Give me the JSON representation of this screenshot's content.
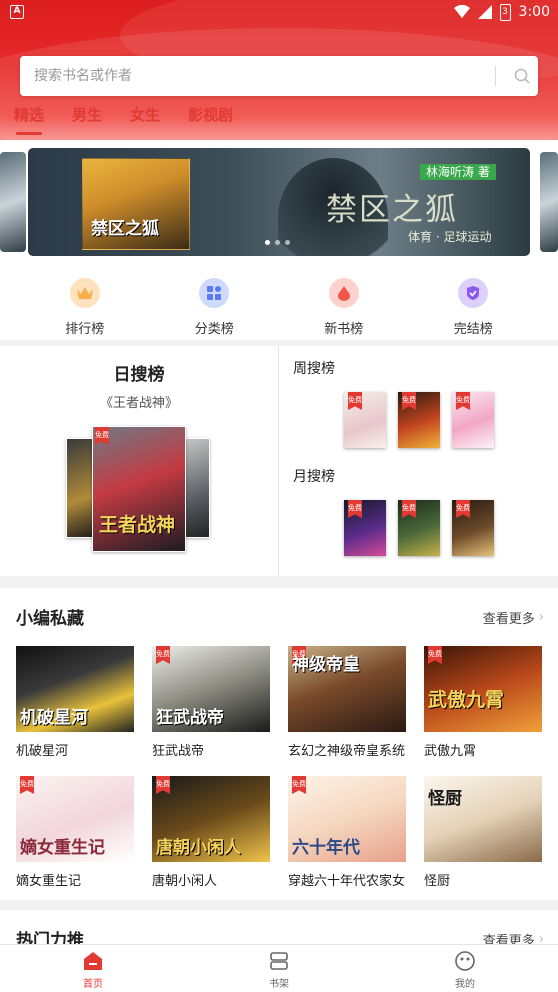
{
  "status_bar": {
    "time": "3:00",
    "battery_level": "3",
    "left_indicator": "A"
  },
  "search": {
    "placeholder": "搜索书名或作者",
    "icon": "search-icon"
  },
  "tabs": [
    {
      "label": "精选",
      "active": true
    },
    {
      "label": "男生",
      "active": false
    },
    {
      "label": "女生",
      "active": false
    },
    {
      "label": "影视剧",
      "active": false
    }
  ],
  "banner": {
    "cover_text": "禁区之狐",
    "author": "林海听涛 著",
    "title": "禁区之狐",
    "subtitle": "体育 · 足球运动",
    "slide_count": 3,
    "active_slide": 1
  },
  "quick_nav": [
    {
      "label": "排行榜",
      "icon": "crown-icon",
      "color": "#f6b04a"
    },
    {
      "label": "分类榜",
      "icon": "grid-icon",
      "color": "#5b7cf0"
    },
    {
      "label": "新书榜",
      "icon": "drop-icon",
      "color": "#f2574a"
    },
    {
      "label": "完结榜",
      "icon": "badge-check-icon",
      "color": "#8a5bee"
    }
  ],
  "rankings": {
    "daily": {
      "title": "日搜榜",
      "book": "《王者战神》",
      "cover_text": "王者战神"
    },
    "weekly": {
      "title": "周搜榜"
    },
    "monthly": {
      "title": "月搜榜"
    }
  },
  "editor_picks": {
    "title": "小编私藏",
    "more": "查看更多",
    "books": [
      {
        "name": "机破星河",
        "cover_text": "机破星河",
        "free": false
      },
      {
        "name": "狂武战帝",
        "cover_text": "狂武战帝",
        "free": true
      },
      {
        "name": "玄幻之神级帝皇系统",
        "cover_text": "神级帝皇",
        "free": true
      },
      {
        "name": "武傲九霄",
        "cover_text": "武傲九霄",
        "free": true
      },
      {
        "name": "嫡女重生记",
        "cover_text": "嫡女重生记",
        "free": true
      },
      {
        "name": "唐朝小闲人",
        "cover_text": "唐朝小闲人",
        "free": true
      },
      {
        "name": "穿越六十年代农家女",
        "cover_text": "六十年代",
        "free": true
      },
      {
        "name": "怪厨",
        "cover_text": "怪厨",
        "free": false
      }
    ]
  },
  "hot": {
    "title": "热门力推",
    "more": "查看更多"
  },
  "free_badge": "免费",
  "bottom_nav": [
    {
      "label": "首页",
      "icon": "home-icon",
      "active": true
    },
    {
      "label": "书架",
      "icon": "bookshelf-icon",
      "active": false
    },
    {
      "label": "我的",
      "icon": "profile-icon",
      "active": false
    }
  ],
  "colors": {
    "brand_red": "#e23a33",
    "header_red": "#dd1e1e"
  }
}
